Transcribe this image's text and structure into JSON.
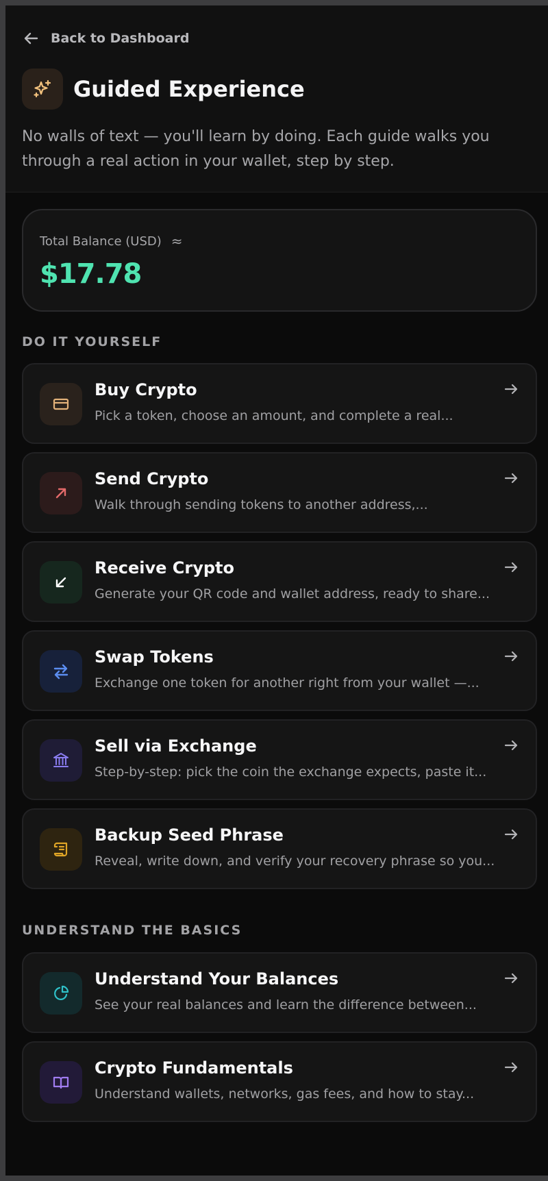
{
  "header": {
    "back_label": "Back to Dashboard",
    "title": "Guided Experience",
    "subtitle": "No walls of text — you'll learn by doing. Each guide walks you through a real action in your wallet, step by step."
  },
  "balance": {
    "label": "Total Balance (USD)",
    "approx_symbol": "≈",
    "value": "$17.78"
  },
  "sections": {
    "diy_title": "DO IT YOURSELF",
    "basics_title": "UNDERSTAND THE BASICS"
  },
  "guides": [
    {
      "name": "Buy Crypto",
      "desc": "Pick a token, choose an amount, and complete a real...",
      "icon": "card-icon",
      "accent": "#e3b27a"
    },
    {
      "name": "Send Crypto",
      "desc": "Walk through sending tokens to another address,...",
      "icon": "arrow-up-right-icon",
      "accent": "#e46a6a"
    },
    {
      "name": "Receive Crypto",
      "desc": "Generate your QR code and wallet address, ready to share...",
      "icon": "arrow-down-left-icon",
      "accent": "#5fd38d"
    },
    {
      "name": "Swap Tokens",
      "desc": "Exchange one token for another right from your wallet —...",
      "icon": "swap-icon",
      "accent": "#5b8df0"
    },
    {
      "name": "Sell via Exchange",
      "desc": "Step-by-step: pick the coin the exchange expects, paste it...",
      "icon": "bank-icon",
      "accent": "#8a7cf0"
    },
    {
      "name": "Backup Seed Phrase",
      "desc": "Reveal, write down, and verify your recovery phrase so you...",
      "icon": "scroll-icon",
      "accent": "#e0a526"
    }
  ],
  "basics": [
    {
      "name": "Understand Your Balances",
      "desc": "See your real balances and learn the difference between...",
      "icon": "pie-chart-icon",
      "accent": "#2fc1c9"
    },
    {
      "name": "Crypto Fundamentals",
      "desc": "Understand wallets, networks, gas fees, and how to stay...",
      "icon": "book-icon",
      "accent": "#a07cf0"
    }
  ]
}
